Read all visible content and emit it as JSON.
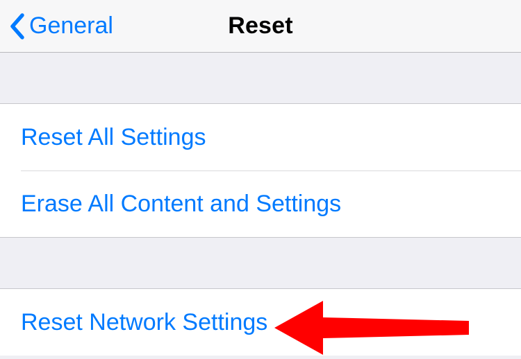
{
  "nav": {
    "back_label": "General",
    "title": "Reset"
  },
  "groups": [
    {
      "rows": [
        {
          "label": "Reset All Settings"
        },
        {
          "label": "Erase All Content and Settings"
        }
      ]
    },
    {
      "rows": [
        {
          "label": "Reset Network Settings"
        }
      ]
    }
  ],
  "colors": {
    "tint": "#007aff",
    "annotation": "#ff0000"
  }
}
